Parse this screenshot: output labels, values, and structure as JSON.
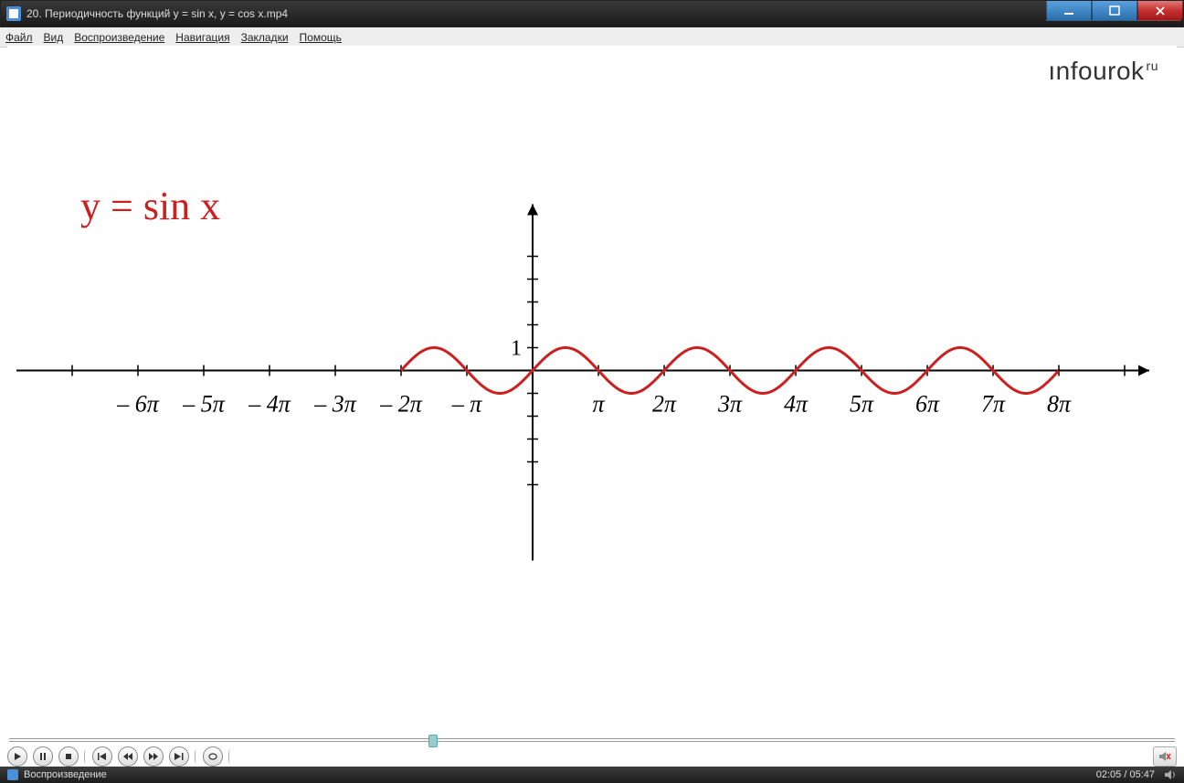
{
  "window": {
    "title": "20. Периодичность функций y = sin x, y = cos x.mp4"
  },
  "menu": {
    "items": [
      "Файл",
      "Вид",
      "Воспроизведение",
      "Навигация",
      "Закладки",
      "Помощь"
    ]
  },
  "brand": {
    "name": "ınfourok",
    "suffix": "ru"
  },
  "chart_data": {
    "type": "line",
    "title": "y = sin x",
    "xlabel": "",
    "ylabel": "",
    "x_tick_labels": [
      "– 6π",
      "– 5π",
      "– 4π",
      "– 3π",
      "– 2π",
      "– π",
      "π",
      "2π",
      "3π",
      "4π",
      "5π",
      "6π",
      "7π",
      "8π"
    ],
    "y_tick_label": "1",
    "curve": {
      "function": "sin(x)",
      "x_start": -6.283,
      "x_end": 25.133,
      "amplitude": 1,
      "period": 6.283
    },
    "xlim": [
      -20,
      27
    ],
    "ylim": [
      -5,
      5
    ],
    "color": "#cc1f1f"
  },
  "player": {
    "progress_fraction": 0.36
  },
  "status": {
    "label": "Воспроизведение",
    "elapsed": "02:05",
    "total": "05:47"
  }
}
